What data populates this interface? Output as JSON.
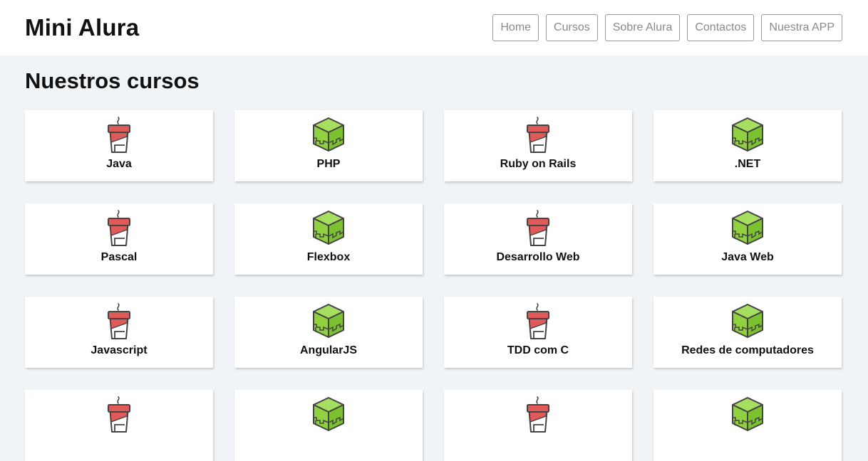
{
  "header": {
    "title": "Mini Alura",
    "nav": [
      {
        "label": "Home",
        "name": "nav-home-button"
      },
      {
        "label": "Cursos",
        "name": "nav-cursos-button"
      },
      {
        "label": "Sobre Alura",
        "name": "nav-sobre-alura-button"
      },
      {
        "label": "Contactos",
        "name": "nav-contactos-button"
      },
      {
        "label": "Nuestra APP",
        "name": "nav-nuestra-app-button"
      }
    ]
  },
  "main": {
    "title": "Nuestros cursos",
    "courses": [
      {
        "label": "Java",
        "icon": "cup-icon"
      },
      {
        "label": "PHP",
        "icon": "cube-icon"
      },
      {
        "label": "Ruby on Rails",
        "icon": "cup-icon"
      },
      {
        "label": ".NET",
        "icon": "cube-icon"
      },
      {
        "label": "Pascal",
        "icon": "cup-icon"
      },
      {
        "label": "Flexbox",
        "icon": "cube-icon"
      },
      {
        "label": "Desarrollo Web",
        "icon": "cup-icon"
      },
      {
        "label": "Java Web",
        "icon": "cube-icon"
      },
      {
        "label": "Javascript",
        "icon": "cup-icon"
      },
      {
        "label": "AngularJS",
        "icon": "cube-icon"
      },
      {
        "label": "TDD com C",
        "icon": "cup-icon"
      },
      {
        "label": "Redes de computadores",
        "icon": "cube-icon"
      },
      {
        "label": "",
        "icon": "cup-icon"
      },
      {
        "label": "",
        "icon": "cube-icon"
      },
      {
        "label": "",
        "icon": "cup-icon"
      },
      {
        "label": "",
        "icon": "cube-icon"
      }
    ]
  },
  "colors": {
    "background": "#f0f4f7",
    "cup_red": "#e05a5a",
    "cube_green": "#8fd13f",
    "outline": "#444444"
  }
}
